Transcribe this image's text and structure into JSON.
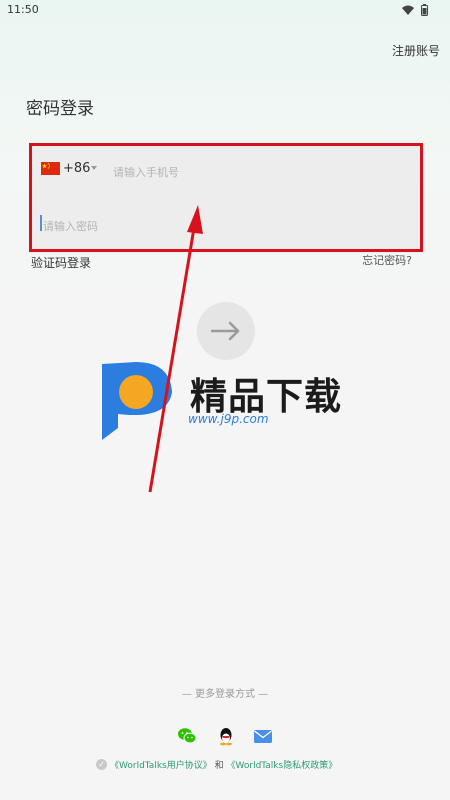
{
  "status_bar": {
    "time": "11:50",
    "icons": [
      "wifi-icon",
      "battery-icon"
    ]
  },
  "header": {
    "register_label": "注册账号"
  },
  "page": {
    "title": "密码登录"
  },
  "form": {
    "country_flag": "cn-flag-icon",
    "country_code": "+86",
    "phone_placeholder": "请输入手机号",
    "phone_value": "",
    "password_placeholder": "请输入密码",
    "password_value": ""
  },
  "links": {
    "sms_login": "验证码登录",
    "forgot_password": "忘记密码?"
  },
  "submit": {
    "icon": "arrow-right-icon"
  },
  "watermark": {
    "text": "精品下载",
    "url": "www.j9p.com"
  },
  "footer": {
    "more_login": "— 更多登录方式 —",
    "socials": [
      "wechat-icon",
      "qq-icon",
      "email-icon"
    ],
    "agreement_user": "《WorldTalks用户协议》",
    "agreement_and": "和",
    "agreement_privacy": "《WorldTalks隐私权政策》"
  },
  "colors": {
    "accent": "#2c9a78",
    "highlight": "#d6131d",
    "watermark_blue": "#2b7de0",
    "watermark_orange": "#f5a623"
  }
}
